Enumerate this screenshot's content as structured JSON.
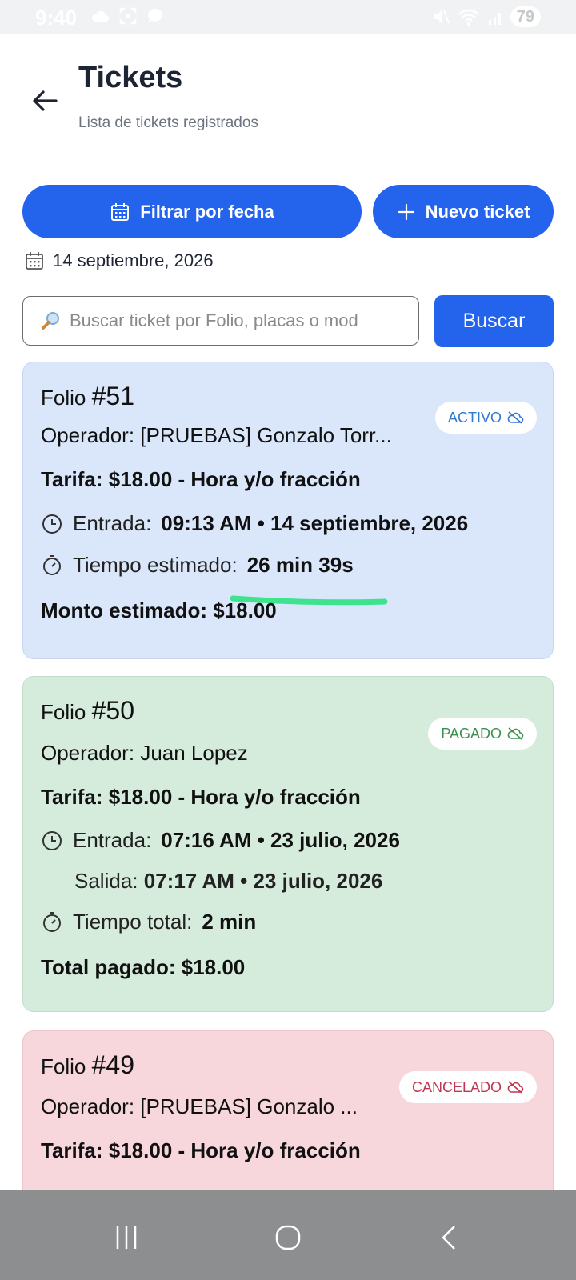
{
  "status_bar": {
    "time": "9:40",
    "battery": "79"
  },
  "header": {
    "title": "Tickets",
    "subtitle": "Lista de tickets registrados"
  },
  "actions": {
    "filter_label": "Filtrar por fecha",
    "new_label": "Nuevo ticket"
  },
  "selected_date": "14 septiembre, 2026",
  "search": {
    "placeholder": "Buscar ticket por Folio, placas o mod",
    "button_label": "Buscar"
  },
  "tickets": [
    {
      "folio_label": "Folio",
      "folio_number": "#51",
      "status": "ACTIVO",
      "operador_label": "Operador:",
      "operador": "[PRUEBAS] Gonzalo Torr...",
      "tarifa": "Tarifa: $18.00 - Hora y/o fracción",
      "entrada_label": "Entrada:",
      "entrada": "09:13 AM  • 14 septiembre, 2026",
      "tiempo_label": "Tiempo estimado:",
      "tiempo": "26 min 39s",
      "monto": "Monto estimado: $18.00"
    },
    {
      "folio_label": "Folio",
      "folio_number": "#50",
      "status": "PAGADO",
      "operador_label": "Operador:",
      "operador": "Juan Lopez",
      "tarifa": "Tarifa: $18.00 - Hora y/o fracción",
      "entrada_label": "Entrada:",
      "entrada": "07:16 AM  • 23 julio, 2026",
      "salida_label": "Salida:",
      "salida": "07:17 AM • 23 julio, 2026",
      "tiempo_label": "Tiempo total:",
      "tiempo": "2 min",
      "monto": "Total pagado: $18.00"
    },
    {
      "folio_label": "Folio",
      "folio_number": "#49",
      "status": "CANCELADO",
      "operador_label": "Operador:",
      "operador": "[PRUEBAS] Gonzalo ...",
      "tarifa": "Tarifa: $18.00 - Hora y/o fracción"
    }
  ],
  "colors": {
    "primary": "#2463eb",
    "card_active": "#dae7fa",
    "card_paid": "#d5ebdb",
    "card_cancelled": "#f7d7db",
    "highlight_stroke": "#3ee38f"
  },
  "icons": {
    "back": "arrow-left-icon",
    "calendar": "calendar-icon",
    "plus": "plus-icon",
    "search": "magnifier-icon",
    "clock": "clock-icon",
    "timer": "timer-icon",
    "cloud_off": "cloud-off-icon"
  }
}
